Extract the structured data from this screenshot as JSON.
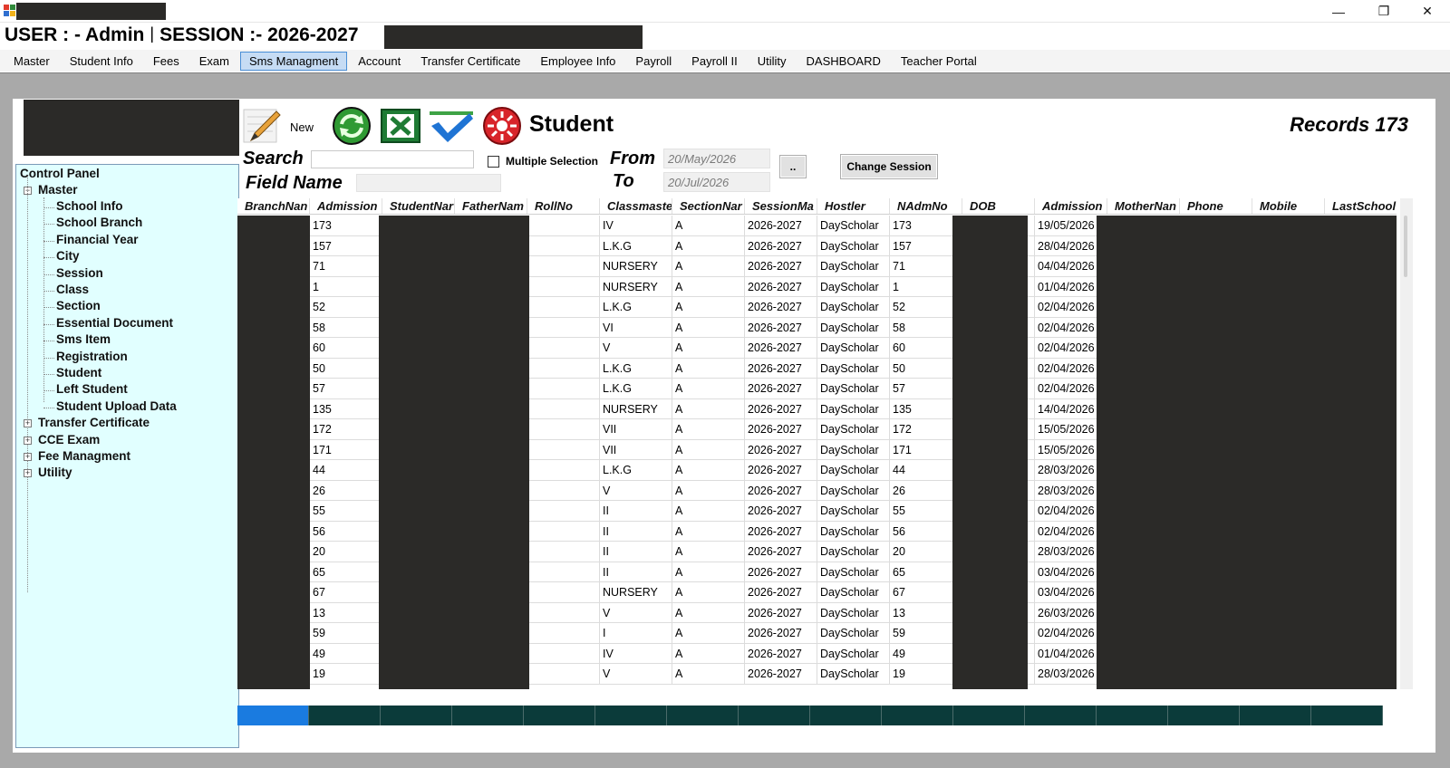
{
  "window": {
    "controls": {
      "minimize": "—",
      "restore": "❐",
      "close": "✕"
    }
  },
  "header": {
    "user": "USER : - Admin",
    "separator": "|",
    "session": "SESSION :- 2026-2027"
  },
  "menu": [
    "Master",
    "Student Info",
    "Fees",
    "Exam",
    "Sms Managment",
    "Account",
    "Transfer Certificate",
    "Employee Info",
    "Payroll",
    "Payroll II",
    "Utility",
    "DASHBOARD",
    "Teacher Portal"
  ],
  "menu_active": "Sms Managment",
  "tree": {
    "root": "Control Panel",
    "master": "Master",
    "master_items": [
      "School Info",
      "School Branch",
      "Financial Year",
      "City",
      "Session",
      "Class",
      "Section",
      "Essential Document",
      "Sms Item",
      "Registration",
      "Student",
      "Left Student",
      "Student Upload Data"
    ],
    "collapsed": [
      "Transfer Certificate",
      "CCE Exam",
      "Fee Managment",
      "Utility"
    ]
  },
  "toolbar": {
    "new_label": "New",
    "form_title": "Student",
    "records": "Records 173",
    "icons": [
      "pencil-icon",
      "refresh-icon",
      "excel-icon",
      "check-icon",
      "cancel-icon"
    ]
  },
  "filters": {
    "search_label": "Search",
    "search_value": "",
    "multi_label": "Multiple Selection",
    "field_label": "Field Name",
    "field_value": "",
    "from_label": "From",
    "from_value": "20/May/2026",
    "to_label": "To",
    "to_value": "20/Jul/2026",
    "browse_label": "..",
    "change_session_label": "Change Session"
  },
  "grid": {
    "columns": [
      "BranchNan",
      "Admission",
      "StudentNar",
      "FatherNam",
      "RollNo",
      "Classmaste",
      "SectionNar",
      "SessionMa",
      "Hostler",
      "NAdmNo",
      "DOB",
      "Admission",
      "MotherNan",
      "Phone",
      "Mobile",
      "LastSchool"
    ],
    "rows": [
      [
        "173",
        "IV",
        "A",
        "2026-2027",
        "DayScholar",
        "173",
        "19/05/2026"
      ],
      [
        "157",
        "L.K.G",
        "A",
        "2026-2027",
        "DayScholar",
        "157",
        "28/04/2026"
      ],
      [
        "71",
        "NURSERY",
        "A",
        "2026-2027",
        "DayScholar",
        "71",
        "04/04/2026"
      ],
      [
        "1",
        "NURSERY",
        "A",
        "2026-2027",
        "DayScholar",
        "1",
        "01/04/2026"
      ],
      [
        "52",
        "L.K.G",
        "A",
        "2026-2027",
        "DayScholar",
        "52",
        "02/04/2026"
      ],
      [
        "58",
        "VI",
        "A",
        "2026-2027",
        "DayScholar",
        "58",
        "02/04/2026"
      ],
      [
        "60",
        "V",
        "A",
        "2026-2027",
        "DayScholar",
        "60",
        "02/04/2026"
      ],
      [
        "50",
        "L.K.G",
        "A",
        "2026-2027",
        "DayScholar",
        "50",
        "02/04/2026"
      ],
      [
        "57",
        "L.K.G",
        "A",
        "2026-2027",
        "DayScholar",
        "57",
        "02/04/2026"
      ],
      [
        "135",
        "NURSERY",
        "A",
        "2026-2027",
        "DayScholar",
        "135",
        "14/04/2026"
      ],
      [
        "172",
        "VII",
        "A",
        "2026-2027",
        "DayScholar",
        "172",
        "15/05/2026"
      ],
      [
        "171",
        "VII",
        "A",
        "2026-2027",
        "DayScholar",
        "171",
        "15/05/2026"
      ],
      [
        "44",
        "L.K.G",
        "A",
        "2026-2027",
        "DayScholar",
        "44",
        "28/03/2026"
      ],
      [
        "26",
        "V",
        "A",
        "2026-2027",
        "DayScholar",
        "26",
        "28/03/2026"
      ],
      [
        "55",
        "II",
        "A",
        "2026-2027",
        "DayScholar",
        "55",
        "02/04/2026"
      ],
      [
        "56",
        "II",
        "A",
        "2026-2027",
        "DayScholar",
        "56",
        "02/04/2026"
      ],
      [
        "20",
        "II",
        "A",
        "2026-2027",
        "DayScholar",
        "20",
        "28/03/2026"
      ],
      [
        "65",
        "II",
        "A",
        "2026-2027",
        "DayScholar",
        "65",
        "03/04/2026"
      ],
      [
        "67",
        "NURSERY",
        "A",
        "2026-2027",
        "DayScholar",
        "67",
        "03/04/2026"
      ],
      [
        "13",
        "V",
        "A",
        "2026-2027",
        "DayScholar",
        "13",
        "26/03/2026"
      ],
      [
        "59",
        "I",
        "A",
        "2026-2027",
        "DayScholar",
        "59",
        "02/04/2026"
      ],
      [
        "49",
        "IV",
        "A",
        "2026-2027",
        "DayScholar",
        "49",
        "01/04/2026"
      ],
      [
        "19",
        "V",
        "A",
        "2026-2027",
        "DayScholar",
        "19",
        "28/03/2026"
      ]
    ]
  },
  "colors": {
    "redaction": "#2b2a28",
    "tree_bg": "#e1ffff",
    "footer_strip": "#0b3b3a",
    "footer_strip_first": "#1a7be0",
    "menu_active": "#c6dcf4"
  }
}
